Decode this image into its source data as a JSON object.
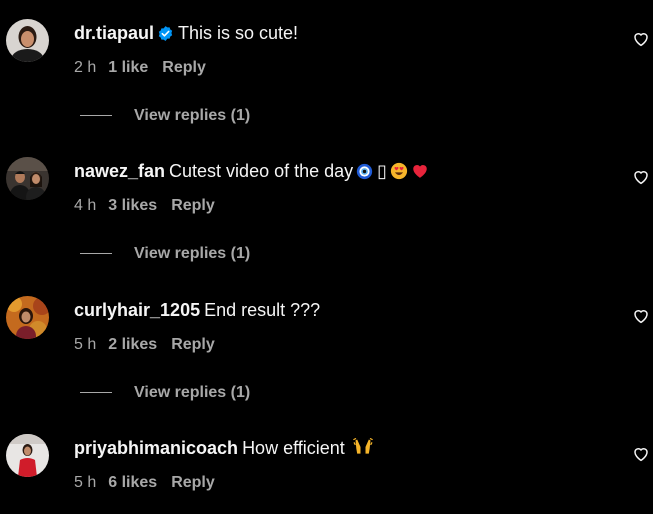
{
  "comments": [
    {
      "username": "dr.tiapaul",
      "verified": true,
      "text": "This is so cute!",
      "time": "2 h",
      "likes": "1 like",
      "reply": "Reply",
      "view_replies": "View replies (1)"
    },
    {
      "username": "nawez_fan",
      "verified": false,
      "text": "Cutest video of the day",
      "emoji_missing_glyph": "▯",
      "emojis": [
        "nazar-amulet",
        "heart-eyes-face",
        "red-heart"
      ],
      "time": "4 h",
      "likes": "3 likes",
      "reply": "Reply",
      "view_replies": "View replies (1)"
    },
    {
      "username": "curlyhair_1205",
      "verified": false,
      "text": "End result ???",
      "time": "5 h",
      "likes": "2 likes",
      "reply": "Reply",
      "view_replies": "View replies (1)"
    },
    {
      "username": "priyabhimanicoach",
      "verified": false,
      "text": "How efficient",
      "emojis": [
        "raising-hands"
      ],
      "time": "5 h",
      "likes": "6 likes",
      "reply": "Reply"
    }
  ],
  "colors": {
    "background": "#000000",
    "primary_text": "#f5f5f5",
    "secondary_text": "#a8a8a8",
    "verified_badge": "#0095f6"
  },
  "icons": {
    "like": "heart-outline-icon",
    "verified": "verified-badge-icon"
  }
}
